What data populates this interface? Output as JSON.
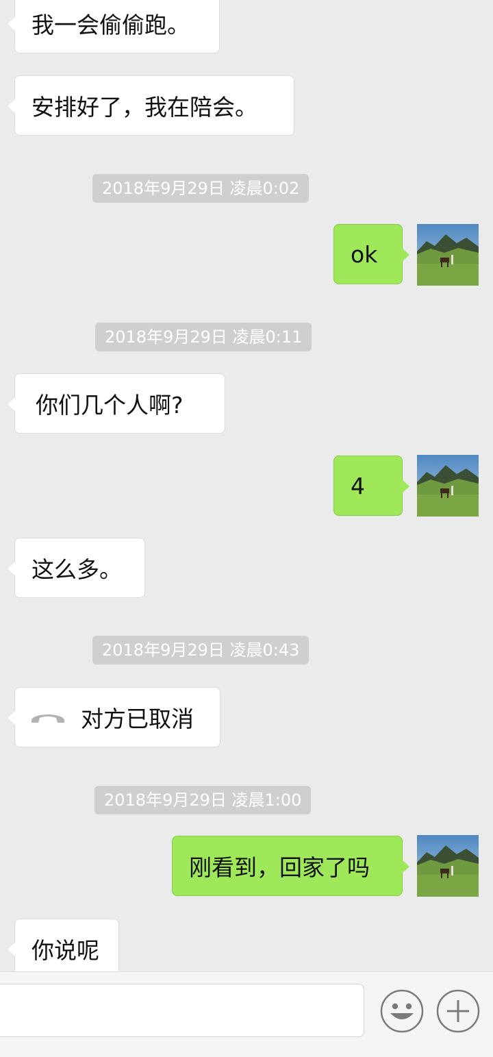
{
  "messages": [
    {
      "dir": "in",
      "text": "我一会偷偷跑。"
    },
    {
      "dir": "in",
      "text": "安排好了，我在陪会。"
    },
    {
      "timestamp": "2018年9月29日 凌晨0:02"
    },
    {
      "dir": "out",
      "text": "ok"
    },
    {
      "timestamp": "2018年9月29日 凌晨0:11"
    },
    {
      "dir": "in",
      "text": "你们几个人啊?"
    },
    {
      "dir": "out",
      "text": "4"
    },
    {
      "dir": "in",
      "text": "这么多。"
    },
    {
      "timestamp": "2018年9月29日 凌晨0:43"
    },
    {
      "dir": "in",
      "type": "call",
      "icon": "phone-hangup-icon",
      "text": "对方已取消"
    },
    {
      "timestamp": "2018年9月29日 凌晨1:00"
    },
    {
      "dir": "out",
      "text": "刚看到，回家了吗"
    },
    {
      "dir": "in",
      "text": "你说呢"
    }
  ],
  "input_bar": {
    "value": "",
    "emoji_icon": "emoji-smile-icon",
    "more_icon": "plus-circle-icon"
  },
  "colors": {
    "background": "#ebebeb",
    "incoming_bubble": "#ffffff",
    "outgoing_bubble": "#9ee85a",
    "timestamp_pill": "#cfcfcf"
  }
}
